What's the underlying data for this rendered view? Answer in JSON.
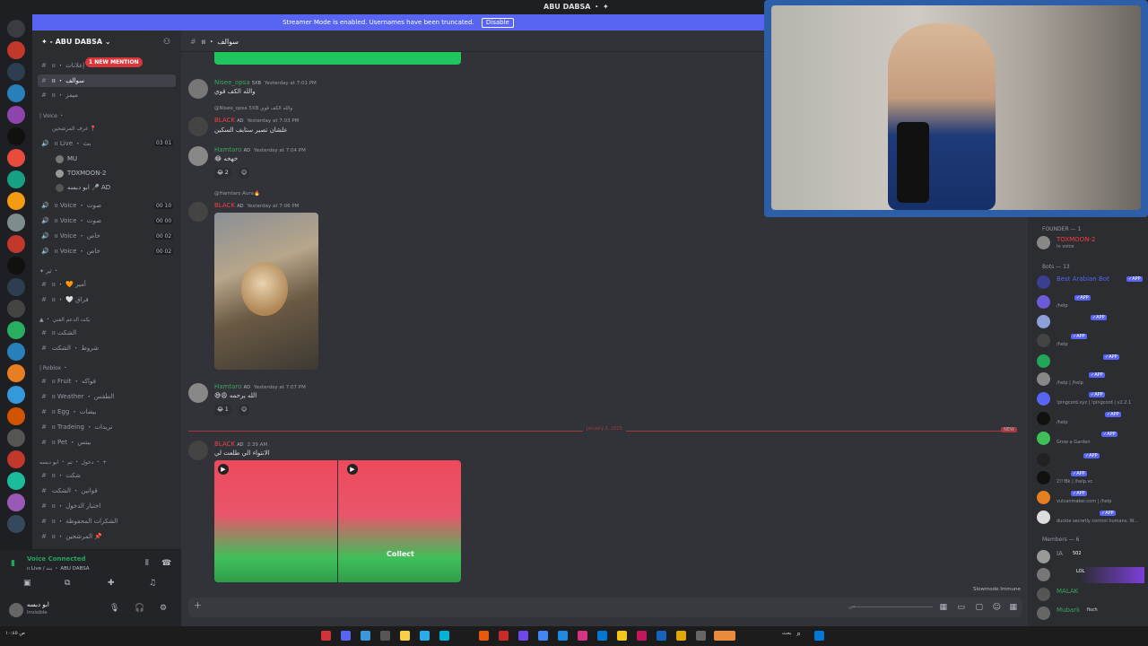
{
  "titlebar": {
    "title": "ABU DABSA ・ ✦"
  },
  "banner": {
    "text": "Streamer Mode is enabled. Usernames have been truncated.",
    "button": "Disable"
  },
  "server": {
    "name": "✦ - ABU DABSA"
  },
  "mention_badge": "1 NEW MENTION",
  "channels": {
    "top": [
      {
        "name": "ıı ・ إعلانات",
        "selected": false
      },
      {
        "name": "ıı ・ سوالف",
        "selected": true
      },
      {
        "name": "ıı ・ ميمز",
        "selected": false
      }
    ],
    "voice_category": "| Voice ・",
    "voice_sub": "غرف المرشحين 📍",
    "live_channel": {
      "name": "ıı Live ・ بث",
      "count": "03 01"
    },
    "voice_users": [
      "MU",
      "TOXMOON-2",
      "ابو دبسه 🎤 AD"
    ],
    "voice_channels": [
      {
        "name": "ıı Voice ・ صوت",
        "count": "00 10"
      },
      {
        "name": "ıı Voice ・ صوت",
        "count": "00 00"
      },
      {
        "name": "ıı Voice ・ خاص",
        "count": "00 02"
      },
      {
        "name": "ıı Voice ・ خاص",
        "count": "00 02"
      }
    ],
    "cat2": "✦ ئير ・",
    "cat2_items": [
      "ıı ・ 🧡 أمير",
      "ıı ・ 🤍 فراق"
    ],
    "cat3": "▲ ・ بكت الدعم الفني",
    "cat3_items": [
      "ıı الشكت",
      "شروط ・ الشكت"
    ],
    "cat4": "| Roblox ・",
    "cat4_items": [
      "ıı Fruit ・ فواكه",
      "ıı Weather ・ الطقس",
      "ıı Egg ・ بيضات",
      "ıı Tradeing ・ تريدات",
      "ıı Pet ・ بيتس"
    ],
    "cat5": "دخول ・ تم ・ ابو دبسه ・ +",
    "cat5_items": [
      "ıı ・ شكت",
      "قوانين ・ الشكت",
      "ıı ・ اختبار الدخول",
      "ıı ・ الشكرات المحفوظة",
      "ıı ・ المرشحين 📌"
    ]
  },
  "voice_connected": {
    "status": "Voice Connected",
    "channel": "ıı Live / بث ・ ABU DABSA"
  },
  "user": {
    "name": "ابو دبسه",
    "status": "Invisible"
  },
  "chat": {
    "channel": "ıı ・ سوالف",
    "messages": [
      {
        "author": "Nisee_opsa",
        "tag": "5XB",
        "time": "Yesterday at 7:01 PM",
        "text": "والله الكف قوي",
        "color": "#3ba55d"
      },
      {
        "author": "BLACK",
        "tag": "AD",
        "time": "Yesterday at 7:03 PM",
        "text": "علشان تصير ستايف السكين",
        "reply": "@Nisee_opsa 5XB والله الكف قوي",
        "color": "#f23f43"
      },
      {
        "author": "Hamtaro",
        "tag": "AD",
        "time": "Yesterday at 7:04 PM",
        "text": "😂 خهخه",
        "color": "#3ba55d",
        "reaction": "😂 2"
      },
      {
        "author": "BLACK",
        "tag": "AD",
        "time": "Yesterday at 7:06 PM",
        "text": "",
        "reply": "@Hamtaro Aura🔥",
        "color": "#f23f43"
      },
      {
        "author": "Hamtaro",
        "tag": "AD",
        "time": "Yesterday at 7:07 PM",
        "text": "😅😩 الله يرحمه",
        "color": "#3ba55d",
        "reaction": "😂 1"
      },
      {
        "author": "BLACK",
        "tag": "AD",
        "time": "2:39 AM",
        "text": "الانتواء الي طلعت لي",
        "color": "#f23f43"
      }
    ],
    "date_divider": "January 3, 2025",
    "new_badge": "NEW",
    "attachment_label": "Collect",
    "slowmode": "Slowmode Immune",
    "composer_placeholder": "ـــــــــــــــــــــــــــــــــــــــــــــــــس"
  },
  "members": {
    "founder_header": "FOUNDER — 1",
    "founder": {
      "name": "TOXMOON-2",
      "status": "In voice"
    },
    "bots_header": "Bots — 13",
    "bots": [
      {
        "name": "Best Arabian Bot",
        "status": ""
      },
      {
        "name": "",
        "status": "/help"
      },
      {
        "name": "",
        "status": ""
      },
      {
        "name": "",
        "status": "/help"
      },
      {
        "name": "",
        "status": ""
      },
      {
        "name": "",
        "status": "/help | /help"
      },
      {
        "name": "",
        "status": "!pingcord.xyz | !pingcord | v2.2.1"
      },
      {
        "name": "",
        "status": "/help"
      },
      {
        "name": "",
        "status": "Grow a Garden"
      },
      {
        "name": "",
        "status": ""
      },
      {
        "name": "",
        "status": "2!!!Bk | /help.vc"
      },
      {
        "name": "",
        "status": "vulcanmaker.com | /help"
      },
      {
        "name": "",
        "status": "duckie secretly control humans, W..."
      }
    ],
    "members_header": "Members — 6",
    "members": [
      {
        "name": "IA",
        "badge": "502"
      },
      {
        "name": "ㅤ",
        "badge": "LOL"
      },
      {
        "name": "MALAK",
        "badge": ""
      },
      {
        "name": "Mubark",
        "badge": "fisch"
      }
    ]
  },
  "taskbar": {
    "left": "ص ١٠:٤٥",
    "search": "بحث"
  }
}
